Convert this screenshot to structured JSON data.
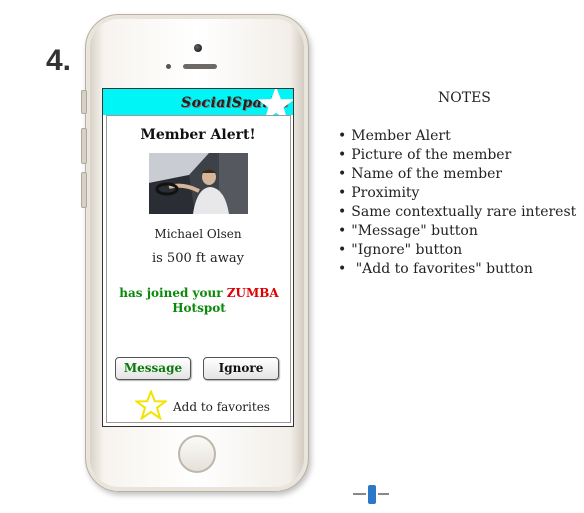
{
  "step_number": "4.",
  "app": {
    "logo_text": "SocialSparks",
    "header_color": "#00f6f6",
    "header_icon": "star-icon"
  },
  "alert": {
    "title": "Member Alert!",
    "photo_icon": "member-photo",
    "member_name": "Michael Olsen",
    "proximity": "is 500 ft away",
    "joined_prefix": "has joined your ",
    "interest": "ZUMBA",
    "joined_suffix": " Hotspot",
    "interest_color": "#e00000",
    "joined_color": "#0a8a0a"
  },
  "buttons": {
    "message_label": "Message",
    "ignore_label": "Ignore"
  },
  "favorites": {
    "icon": "star-outline-icon",
    "label": "Add to favorites"
  },
  "notes": {
    "title": "NOTES",
    "items": [
      "Member Alert",
      "Picture of the member",
      "Name of the member",
      "Proximity",
      "Same contextually rare interest",
      "\"Message\" button",
      "\"Ignore\" button",
      " \"Add to favorites\" button"
    ]
  }
}
